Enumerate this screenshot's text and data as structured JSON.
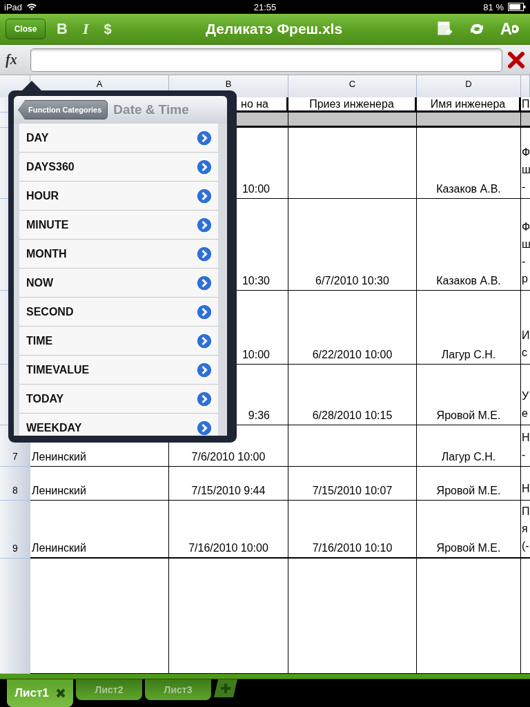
{
  "status_bar": {
    "device": "iPad",
    "time": "21:55",
    "battery": "81 %"
  },
  "toolbar": {
    "close": "Close",
    "title": "Деликатэ Фреш.xls",
    "format_tools": [
      {
        "kind": "bold",
        "label": "B"
      },
      {
        "kind": "italic",
        "label": "I"
      },
      {
        "kind": "currency",
        "label": "$"
      }
    ],
    "right_tools": [
      {
        "kind": "insert"
      },
      {
        "kind": "sync"
      },
      {
        "kind": "font-settings",
        "label": "A"
      }
    ]
  },
  "formula_bar": {
    "label": "fx"
  },
  "sheet": {
    "columns": [
      "A",
      "B",
      "C",
      "D"
    ],
    "header_rows": [
      {
        "b": "но на",
        "c": "Приез инженера",
        "d": "Имя инженера",
        "e": "П"
      },
      {}
    ],
    "rows": [
      {
        "b": "10:00",
        "d": "Казаков А.В.",
        "e": "Ф\nш\n-"
      },
      {
        "b": "10:30",
        "c": "6/7/2010 10:30",
        "d": "Казаков А.В.",
        "e": "Ф\nш\n-\nр"
      },
      {
        "b": "10:00",
        "c": "6/22/2010 10:00",
        "d": "Лагур  С.Н.",
        "e": "И\nс"
      },
      {
        "b": "9:36",
        "c": "6/28/2010 10:15",
        "d": "Яровой М.Е.",
        "e": "У\nе"
      },
      {
        "number": "7",
        "a": "Ленинский",
        "b": "7/6/2010 10:00",
        "d": "Лагур  С.Н.",
        "e": "Н\n-"
      },
      {
        "number": "8",
        "a": "Ленинский",
        "b": "7/15/2010 9:44",
        "c": "7/15/2010 10:07",
        "d": "Яровой М.Е.",
        "e": "Н"
      },
      {
        "number": "9",
        "a": "Ленинский",
        "b": "7/16/2010 10:00",
        "c": "7/16/2010 10:10",
        "d": "Яровой М.Е.",
        "e": "П\nя\n(-"
      }
    ]
  },
  "popover": {
    "back": "Function Categories",
    "title": "Date & Time",
    "items": [
      "DAY",
      "DAYS360",
      "HOUR",
      "MINUTE",
      "MONTH",
      "NOW",
      "SECOND",
      "TIME",
      "TIMEVALUE",
      "TODAY",
      "WEEKDAY"
    ]
  },
  "sheet_tabs": [
    {
      "label": "Лист1",
      "selected": true
    },
    {
      "label": "Лист2",
      "selected": false
    },
    {
      "label": "Лист3",
      "selected": false
    }
  ]
}
